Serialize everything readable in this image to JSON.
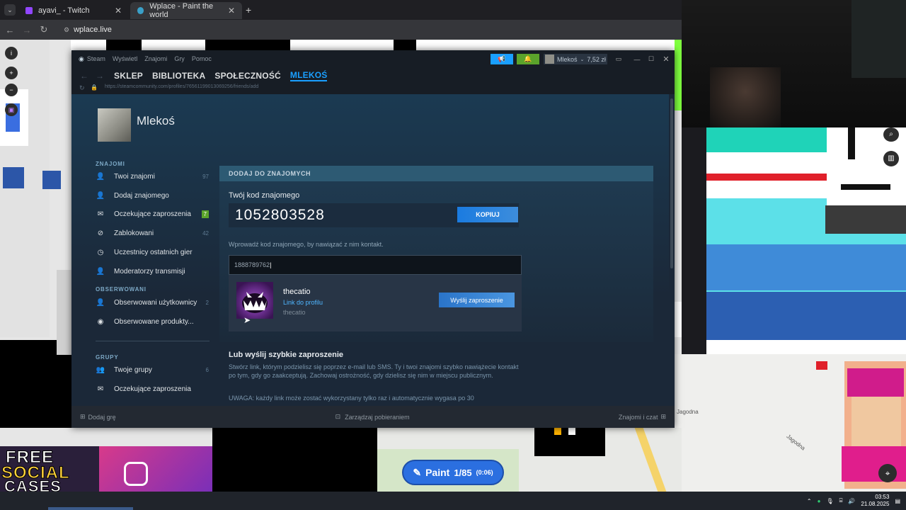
{
  "browser": {
    "tabs": [
      {
        "label": "ayavi_ - Twitch",
        "active": false,
        "color": "#9146ff"
      },
      {
        "label": "Wplace - Paint the world",
        "active": true,
        "color": "#3aa0c8"
      }
    ],
    "new_tab": "+",
    "url": "wplace.live"
  },
  "steam": {
    "menu": [
      "Steam",
      "Wyświetl",
      "Znajomi",
      "Gry",
      "Pomoc"
    ],
    "user": {
      "name": "Mlekoś",
      "wallet": "7,52 zł"
    },
    "nav": [
      "SKLEP",
      "BIBLIOTEKA",
      "SPOŁECZNOŚĆ",
      "MLEKOŚ"
    ],
    "page_url": "https://steamcommunity.com/profiles/76561199013069256/friends/add",
    "profile_name": "Mlekoś",
    "sidebar": {
      "friends_header": "ZNAJOMI",
      "friends_items": [
        {
          "label": "Twoi znajomi",
          "count": "97",
          "icon": "person-icon"
        },
        {
          "label": "Dodaj znajomego",
          "count": "",
          "icon": "add-person-icon"
        },
        {
          "label": "Oczekujące zaproszenia",
          "count": "7",
          "icon": "envelope-icon"
        },
        {
          "label": "Zablokowani",
          "count": "42",
          "icon": "blocked-icon"
        },
        {
          "label": "Uczestnicy ostatnich gier",
          "count": "",
          "icon": "clock-icon"
        },
        {
          "label": "Moderatorzy transmisji",
          "count": "",
          "icon": "person-icon"
        }
      ],
      "followed_header": "OBSERWOWANI",
      "followed_items": [
        {
          "label": "Obserwowani użytkownicy",
          "count": "2",
          "icon": "person-follow-icon"
        },
        {
          "label": "Obserwowane produkty...",
          "count": "",
          "icon": "eye-icon"
        }
      ],
      "groups_header": "GRUPY",
      "groups_items": [
        {
          "label": "Twoje grupy",
          "count": "6",
          "icon": "group-icon"
        },
        {
          "label": "Oczekujące zaproszenia",
          "count": "",
          "icon": "envelope-icon"
        }
      ]
    },
    "add_friend": {
      "header": "DODAJ DO ZNAJOMYCH",
      "code_label": "Twój kod znajomego",
      "code": "1052803528",
      "copy_button": "KOPIUJ",
      "hint": "Wprowadź kod znajomego, by nawiązać z nim kontakt.",
      "input_value": "1888789762",
      "result": {
        "name": "thecatio",
        "link": "Link do profilu",
        "alias": "thecatio",
        "invite_button": "Wyślij zaproszenie"
      }
    },
    "quick_invite": {
      "header": "Lub wyślij szybkie zaproszenie",
      "text": "Stwórz link, którym podzielisz się poprzez e-mail lub SMS. Ty i twoi znajomi szybko nawiążecie kontakt po tym, gdy go zaakceptują. Zachowaj ostrożność, gdy dzielisz się nim w miejscu publicznym.",
      "warning": "UWAGA: każdy link może zostać wykorzystany tylko raz i automatycznie wygasa po 30"
    },
    "bottom": {
      "add_game": "Dodaj grę",
      "downloads": "Zarządzaj pobieraniem",
      "friends_chat": "Znajomi i czat"
    }
  },
  "wplace": {
    "paint_label": "Paint",
    "paint_count": "1/85",
    "paint_timer": "(0:06)",
    "street": "Jagodna"
  },
  "promo": {
    "line1": "FREE",
    "line2": "SOCIAL",
    "line3": "CASES"
  },
  "taskbar": {
    "time": "03:53",
    "date": "21.08.2025"
  }
}
